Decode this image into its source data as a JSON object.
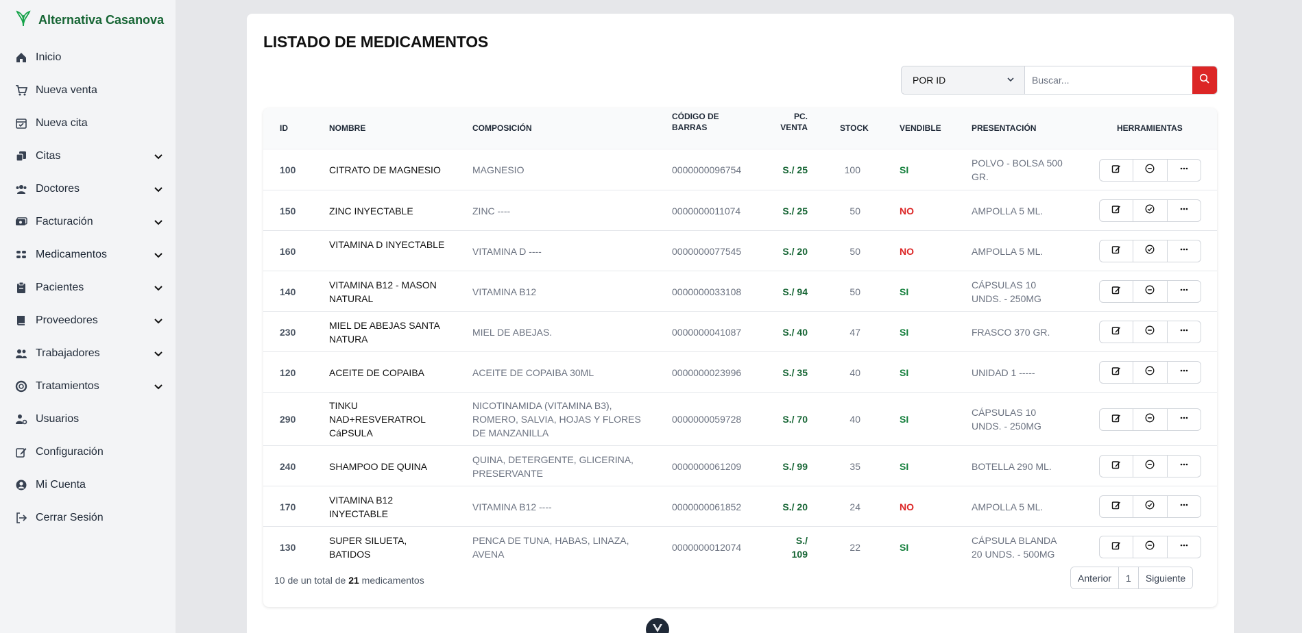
{
  "brand": {
    "name": "Alternativa Casanova",
    "color": "#166534"
  },
  "sidebar": {
    "items": [
      {
        "label": "Inicio",
        "icon": "home-icon",
        "expandable": false
      },
      {
        "label": "Nueva venta",
        "icon": "cart-icon",
        "expandable": false
      },
      {
        "label": "Nueva cita",
        "icon": "calendar-icon",
        "expandable": false
      },
      {
        "label": "Citas",
        "icon": "copy-icon",
        "expandable": true
      },
      {
        "label": "Doctores",
        "icon": "users-icon",
        "expandable": true
      },
      {
        "label": "Facturación",
        "icon": "money-icon",
        "expandable": true
      },
      {
        "label": "Medicamentos",
        "icon": "pills-icon",
        "expandable": true
      },
      {
        "label": "Pacientes",
        "icon": "clipboard-icon",
        "expandable": true
      },
      {
        "label": "Proveedores",
        "icon": "book-icon",
        "expandable": true
      },
      {
        "label": "Trabajadores",
        "icon": "team-icon",
        "expandable": true
      },
      {
        "label": "Tratamientos",
        "icon": "lifering-icon",
        "expandable": true
      },
      {
        "label": "Usuarios",
        "icon": "user-gear-icon",
        "expandable": false
      },
      {
        "label": "Configuración",
        "icon": "edit-icon",
        "expandable": false
      },
      {
        "label": "Mi Cuenta",
        "icon": "user-circle-icon",
        "expandable": false
      },
      {
        "label": "Cerrar Sesión",
        "icon": "sign-out-icon",
        "expandable": false
      }
    ]
  },
  "page": {
    "title": "LISTADO DE MEDICAMENTOS"
  },
  "search": {
    "filter_value": "POR ID",
    "placeholder": "Buscar...",
    "button_color": "#dc2626"
  },
  "table": {
    "headers": {
      "id": "ID",
      "nombre": "NOMBRE",
      "composicion": "COMPOSICIÓN",
      "codigo1": "CÓDIGO DE",
      "codigo2": "BARRAS",
      "pc1": "PC.",
      "pc2": "VENTA",
      "stock": "STOCK",
      "vendible": "VENDIBLE",
      "presentacion": "PRESENTACIÓN",
      "herramientas": "HERRAMIENTAS"
    },
    "rows": [
      {
        "id": "100",
        "nombre": "CITRATO DE MAGNESIO",
        "composicion": "MAGNESIO",
        "codigo": "0000000096754",
        "precio": "S./ 25",
        "stock": "100",
        "vendible": "SI",
        "presentacion": "POLVO - BOLSA 500 GR.",
        "toggle": "disable"
      },
      {
        "id": "150",
        "nombre": "ZINC INYECTABLE",
        "composicion": "ZINC ----",
        "codigo": "0000000011074",
        "precio": "S./ 25",
        "stock": "50",
        "vendible": "NO",
        "presentacion": "AMPOLLA 5 ML.",
        "toggle": "enable"
      },
      {
        "id": "160",
        "nombre": "VITAMINA D INYECTABLE",
        "composicion": "VITAMINA D ----",
        "codigo": "0000000077545",
        "precio": "S./ 20",
        "stock": "50",
        "vendible": "NO",
        "presentacion": "AMPOLLA 5 ML.",
        "toggle": "enable"
      },
      {
        "id": "140",
        "nombre": "VITAMINA B12 - MASON NATURAL",
        "composicion": "VITAMINA B12",
        "codigo": "0000000033108",
        "precio": "S./ 94",
        "stock": "50",
        "vendible": "SI",
        "presentacion": "CÁPSULAS 10 UNDS. - 250MG",
        "toggle": "disable"
      },
      {
        "id": "230",
        "nombre": "MIEL DE ABEJAS SANTA NATURA",
        "composicion": "MIEL DE ABEJAS.",
        "codigo": "0000000041087",
        "precio": "S./ 40",
        "stock": "47",
        "vendible": "SI",
        "presentacion": "FRASCO 370 GR.",
        "toggle": "disable"
      },
      {
        "id": "120",
        "nombre": "ACEITE DE COPAIBA",
        "composicion": "ACEITE DE COPAIBA 30ML",
        "codigo": "0000000023996",
        "precio": "S./ 35",
        "stock": "40",
        "vendible": "SI",
        "presentacion": "UNIDAD 1 -----",
        "toggle": "disable"
      },
      {
        "id": "290",
        "nombre": "TINKU NAD+RESVERATROL CáPSULA",
        "composicion": "NICOTINAMIDA (VITAMINA B3), ROMERO, SALVIA, HOJAS Y FLORES DE MANZANILLA",
        "codigo": "0000000059728",
        "precio": "S./ 70",
        "stock": "40",
        "vendible": "SI",
        "presentacion": "CÁPSULAS 10 UNDS. - 250MG",
        "toggle": "disable"
      },
      {
        "id": "240",
        "nombre": "SHAMPOO DE QUINA",
        "composicion": "QUINA, DETERGENTE, GLICERINA, PRESERVANTE",
        "codigo": "0000000061209",
        "precio": "S./ 99",
        "stock": "35",
        "vendible": "SI",
        "presentacion": "BOTELLA 290 ML.",
        "toggle": "disable"
      },
      {
        "id": "170",
        "nombre": "VITAMINA B12 INYECTABLE",
        "composicion": "VITAMINA B12 ----",
        "codigo": "0000000061852",
        "precio": "S./ 20",
        "stock": "24",
        "vendible": "NO",
        "presentacion": "AMPOLLA 5 ML.",
        "toggle": "enable"
      },
      {
        "id": "130",
        "nombre": "SUPER SILUETA, BATIDOS",
        "composicion": "PENCA DE TUNA, HABAS, LINAZA, AVENA",
        "codigo": "0000000012074",
        "precio": "S./ 109",
        "stock": "22",
        "vendible": "SI",
        "presentacion": "CÁPSULA BLANDA 20 UNDS. - 500MG",
        "toggle": "disable"
      }
    ]
  },
  "footer": {
    "shown": "10 de un total de",
    "total": "21",
    "unit": "medicamentos",
    "prev": "Anterior",
    "page": "1",
    "next": "Siguiente"
  },
  "colors": {
    "si": "#15803d",
    "no": "#dc2626",
    "price": "#166534"
  }
}
